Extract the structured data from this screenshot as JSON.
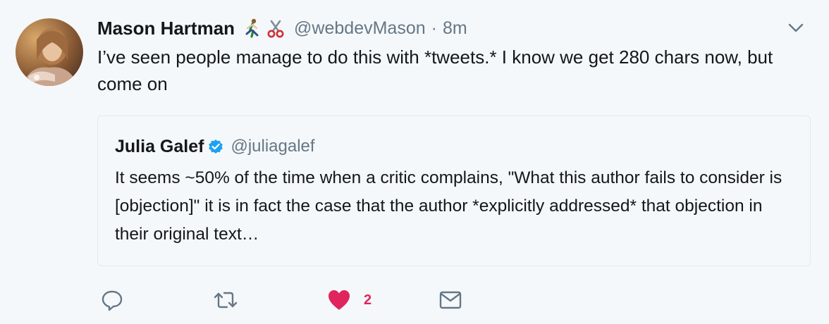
{
  "tweet": {
    "display_name": "Mason Hartman",
    "name_emojis": [
      "runner-emoji",
      "scissors-emoji"
    ],
    "handle": "@webdevMason",
    "separator": "·",
    "time": "8m",
    "text": "I’ve seen people manage to do this with *tweets.* I know we get 280 chars now, but come on",
    "menu_icon": "chevron-down-icon"
  },
  "quote": {
    "display_name": "Julia Galef",
    "verified": true,
    "handle": "@juliagalef",
    "text": "It seems ~50% of the time when a critic complains, \"What this author fails to consider is [objection]\" it is in fact the case that the author *explicitly addressed* that objection in their original text…"
  },
  "actions": {
    "reply_icon": "reply-icon",
    "retweet_icon": "retweet-icon",
    "like_icon": "heart-icon",
    "like_count": "2",
    "dm_icon": "envelope-icon"
  },
  "colors": {
    "background": "#f5f8fa",
    "text": "#14171a",
    "secondary": "#657786",
    "like": "#e0245e",
    "verified": "#1da1f2",
    "border": "#e1e8ed"
  }
}
